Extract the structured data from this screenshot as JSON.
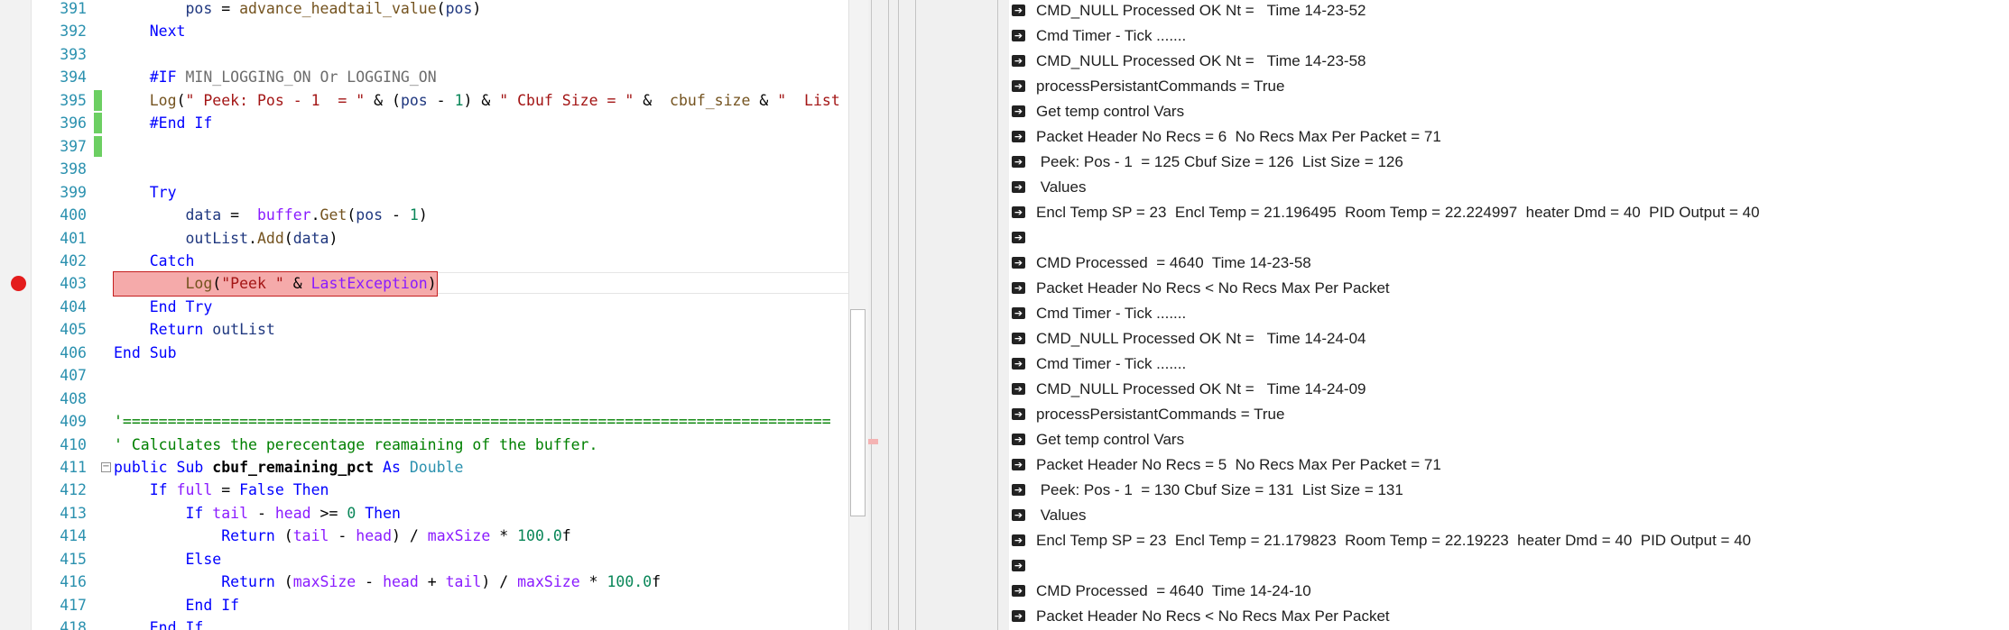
{
  "editor": {
    "lines": [
      {
        "no": "391",
        "segs": [
          {
            "t": "        "
          },
          {
            "t": "pos",
            "c": "i"
          },
          {
            "t": " = "
          },
          {
            "t": "advance_headtail_value",
            "c": "f"
          },
          {
            "t": "("
          },
          {
            "t": "pos",
            "c": "i"
          },
          {
            "t": ")"
          }
        ]
      },
      {
        "no": "392",
        "segs": [
          {
            "t": "    "
          },
          {
            "t": "Next",
            "c": "k"
          }
        ]
      },
      {
        "no": "393",
        "segs": []
      },
      {
        "no": "394",
        "segs": [
          {
            "t": "    "
          },
          {
            "t": "#IF",
            "c": "k"
          },
          {
            "t": " MIN_LOGGING_ON Or LOGGING_ON",
            "c": "x"
          }
        ]
      },
      {
        "no": "395",
        "changed": true,
        "segs": [
          {
            "t": "    "
          },
          {
            "t": "Log",
            "c": "f"
          },
          {
            "t": "("
          },
          {
            "t": "\" Peek: Pos - 1  = \"",
            "c": "s"
          },
          {
            "t": " & ("
          },
          {
            "t": "pos",
            "c": "i"
          },
          {
            "t": " - "
          },
          {
            "t": "1",
            "c": "n"
          },
          {
            "t": ") & "
          },
          {
            "t": "\" Cbuf Size = \"",
            "c": "s"
          },
          {
            "t": " &  "
          },
          {
            "t": "cbuf_size",
            "c": "f"
          },
          {
            "t": " & "
          },
          {
            "t": "\"  List Size = \"",
            "c": "s"
          }
        ]
      },
      {
        "no": "396",
        "changed": true,
        "segs": [
          {
            "t": "    "
          },
          {
            "t": "#End If",
            "c": "k"
          }
        ]
      },
      {
        "no": "397",
        "changed": true,
        "segs": []
      },
      {
        "no": "398",
        "segs": []
      },
      {
        "no": "399",
        "segs": [
          {
            "t": "    "
          },
          {
            "t": "Try",
            "c": "k"
          }
        ]
      },
      {
        "no": "400",
        "segs": [
          {
            "t": "        "
          },
          {
            "t": "data",
            "c": "i"
          },
          {
            "t": " =  "
          },
          {
            "t": "buffer",
            "c": "v"
          },
          {
            "t": "."
          },
          {
            "t": "Get",
            "c": "f"
          },
          {
            "t": "("
          },
          {
            "t": "pos",
            "c": "i"
          },
          {
            "t": " - "
          },
          {
            "t": "1",
            "c": "n"
          },
          {
            "t": ")"
          }
        ]
      },
      {
        "no": "401",
        "segs": [
          {
            "t": "        "
          },
          {
            "t": "outList",
            "c": "i"
          },
          {
            "t": "."
          },
          {
            "t": "Add",
            "c": "f"
          },
          {
            "t": "("
          },
          {
            "t": "data",
            "c": "i"
          },
          {
            "t": ")"
          }
        ]
      },
      {
        "no": "402",
        "segs": [
          {
            "t": "    "
          },
          {
            "t": "Catch",
            "c": "k"
          }
        ]
      },
      {
        "no": "403",
        "breakpoint": true,
        "current": true,
        "segs": [
          {
            "t": "        "
          },
          {
            "t": "Log",
            "c": "f"
          },
          {
            "t": "("
          },
          {
            "t": "\"Peek \"",
            "c": "s"
          },
          {
            "t": " & "
          },
          {
            "t": "LastException",
            "c": "v"
          },
          {
            "t": ")"
          }
        ]
      },
      {
        "no": "404",
        "segs": [
          {
            "t": "    "
          },
          {
            "t": "End Try",
            "c": "k"
          }
        ]
      },
      {
        "no": "405",
        "segs": [
          {
            "t": "    "
          },
          {
            "t": "Return",
            "c": "k"
          },
          {
            "t": " "
          },
          {
            "t": "outList",
            "c": "i"
          }
        ]
      },
      {
        "no": "406",
        "segs": [
          {
            "t": "End Sub",
            "c": "k"
          }
        ]
      },
      {
        "no": "407",
        "segs": []
      },
      {
        "no": "408",
        "segs": []
      },
      {
        "no": "409",
        "segs": [
          {
            "t": "'===============================================================================",
            "c": "c"
          }
        ]
      },
      {
        "no": "410",
        "segs": [
          {
            "t": "' Calculates the perecentage reamaining of the buffer.",
            "c": "c"
          }
        ]
      },
      {
        "no": "411",
        "fold": "−",
        "segs": [
          {
            "t": "public",
            "c": "k"
          },
          {
            "t": " "
          },
          {
            "t": "Sub",
            "c": "k"
          },
          {
            "t": " "
          },
          {
            "t": "cbuf_remaining_pct",
            "c": "b"
          },
          {
            "t": " "
          },
          {
            "t": "As",
            "c": "k"
          },
          {
            "t": " "
          },
          {
            "t": "Double",
            "c": "t"
          }
        ]
      },
      {
        "no": "412",
        "segs": [
          {
            "t": "    "
          },
          {
            "t": "If",
            "c": "k"
          },
          {
            "t": " "
          },
          {
            "t": "full",
            "c": "v"
          },
          {
            "t": " = "
          },
          {
            "t": "False",
            "c": "k"
          },
          {
            "t": " "
          },
          {
            "t": "Then",
            "c": "k"
          }
        ]
      },
      {
        "no": "413",
        "segs": [
          {
            "t": "        "
          },
          {
            "t": "If",
            "c": "k"
          },
          {
            "t": " "
          },
          {
            "t": "tail",
            "c": "v"
          },
          {
            "t": " - "
          },
          {
            "t": "head",
            "c": "v"
          },
          {
            "t": " >= "
          },
          {
            "t": "0",
            "c": "n"
          },
          {
            "t": " "
          },
          {
            "t": "Then",
            "c": "k"
          }
        ]
      },
      {
        "no": "414",
        "segs": [
          {
            "t": "            "
          },
          {
            "t": "Return",
            "c": "k"
          },
          {
            "t": " ("
          },
          {
            "t": "tail",
            "c": "v"
          },
          {
            "t": " - "
          },
          {
            "t": "head",
            "c": "v"
          },
          {
            "t": ") / "
          },
          {
            "t": "maxSize",
            "c": "v"
          },
          {
            "t": " * "
          },
          {
            "t": "100.0",
            "c": "n"
          },
          {
            "t": "f"
          }
        ]
      },
      {
        "no": "415",
        "segs": [
          {
            "t": "        "
          },
          {
            "t": "Else",
            "c": "k"
          }
        ]
      },
      {
        "no": "416",
        "segs": [
          {
            "t": "            "
          },
          {
            "t": "Return",
            "c": "k"
          },
          {
            "t": " ("
          },
          {
            "t": "maxSize",
            "c": "v"
          },
          {
            "t": " - "
          },
          {
            "t": "head",
            "c": "v"
          },
          {
            "t": " + "
          },
          {
            "t": "tail",
            "c": "v"
          },
          {
            "t": ") / "
          },
          {
            "t": "maxSize",
            "c": "v"
          },
          {
            "t": " * "
          },
          {
            "t": "100.0",
            "c": "n"
          },
          {
            "t": "f"
          }
        ]
      },
      {
        "no": "417",
        "segs": [
          {
            "t": "        "
          },
          {
            "t": "End If",
            "c": "k"
          }
        ]
      },
      {
        "no": "418",
        "segs": [
          {
            "t": "    "
          },
          {
            "t": "End If",
            "c": "k"
          }
        ]
      }
    ]
  },
  "log": {
    "icon": "arrow-right-icon",
    "lines": [
      "CMD_NULL Processed OK Nt =   Time 14-23-52",
      "Cmd Timer - Tick .......",
      "CMD_NULL Processed OK Nt =   Time 14-23-58",
      "processPersistantCommands = True",
      "Get temp control Vars",
      "Packet Header No Recs = 6  No Recs Max Per Packet = 71",
      " Peek: Pos - 1  = 125 Cbuf Size = 126  List Size = 126",
      " Values",
      "Encl Temp SP = 23  Encl Temp = 21.196495  Room Temp = 22.224997  heater Dmd = 40  PID Output = 40",
      "",
      "CMD Processed  = 4640  Time 14-23-58",
      "Packet Header No Recs < No Recs Max Per Packet",
      "Cmd Timer - Tick .......",
      "CMD_NULL Processed OK Nt =   Time 14-24-04",
      "Cmd Timer - Tick .......",
      "CMD_NULL Processed OK Nt =   Time 14-24-09",
      "processPersistantCommands = True",
      "Get temp control Vars",
      "Packet Header No Recs = 5  No Recs Max Per Packet = 71",
      " Peek: Pos - 1  = 130 Cbuf Size = 131  List Size = 131",
      " Values",
      "Encl Temp SP = 23  Encl Temp = 21.179823  Room Temp = 22.19223  heater Dmd = 40  PID Output = 40",
      "",
      "CMD Processed  = 4640  Time 14-24-10",
      "Packet Header No Recs < No Recs Max Per Packet"
    ]
  }
}
